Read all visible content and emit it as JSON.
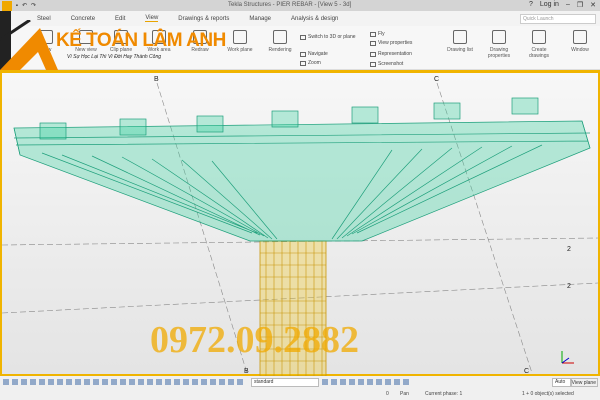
{
  "window": {
    "title": "Tekla Structures - PIER REBAR - [View 5 - 3d]",
    "help": "?",
    "login": "Log in"
  },
  "menu": [
    "Steel",
    "Concrete",
    "Edit",
    "View",
    "Drawings & reports",
    "Manage",
    "Analysis & design"
  ],
  "quick_launch": {
    "placeholder": "Quick Launch"
  },
  "ribbon": {
    "big": [
      "View",
      "New view",
      "Clip plane",
      "Work area",
      "Redraw",
      "Work plane",
      "Rendering",
      "Drawing list",
      "Drawing properties",
      "Create drawings",
      "Window"
    ],
    "small": [
      "Switch to 3D or plane",
      "Navigate",
      "Zoom",
      "Fly",
      "View properties",
      "Representation",
      "Screenshot"
    ]
  },
  "grid_labels": [
    "B",
    "C",
    "B",
    "C",
    "2",
    "2"
  ],
  "watermark": {
    "brand": "KẾ TOÁN LÂM ANH",
    "slogan": "Vì Sự Học Lại Thì Vì Đời Hay Thành Công",
    "phone": "0972.09.2882"
  },
  "toolbar": {
    "select": "standard",
    "auto": "Auto",
    "view_plane": "View plane"
  },
  "status": {
    "count": "0",
    "mode": "Pan",
    "phase": "Current phase: 1",
    "selected": "1 + 0 object(s) selected"
  },
  "colors": {
    "accent": "#f0b400",
    "rebar_cap": "#2fbf96",
    "rebar_column": "#e0b020"
  }
}
